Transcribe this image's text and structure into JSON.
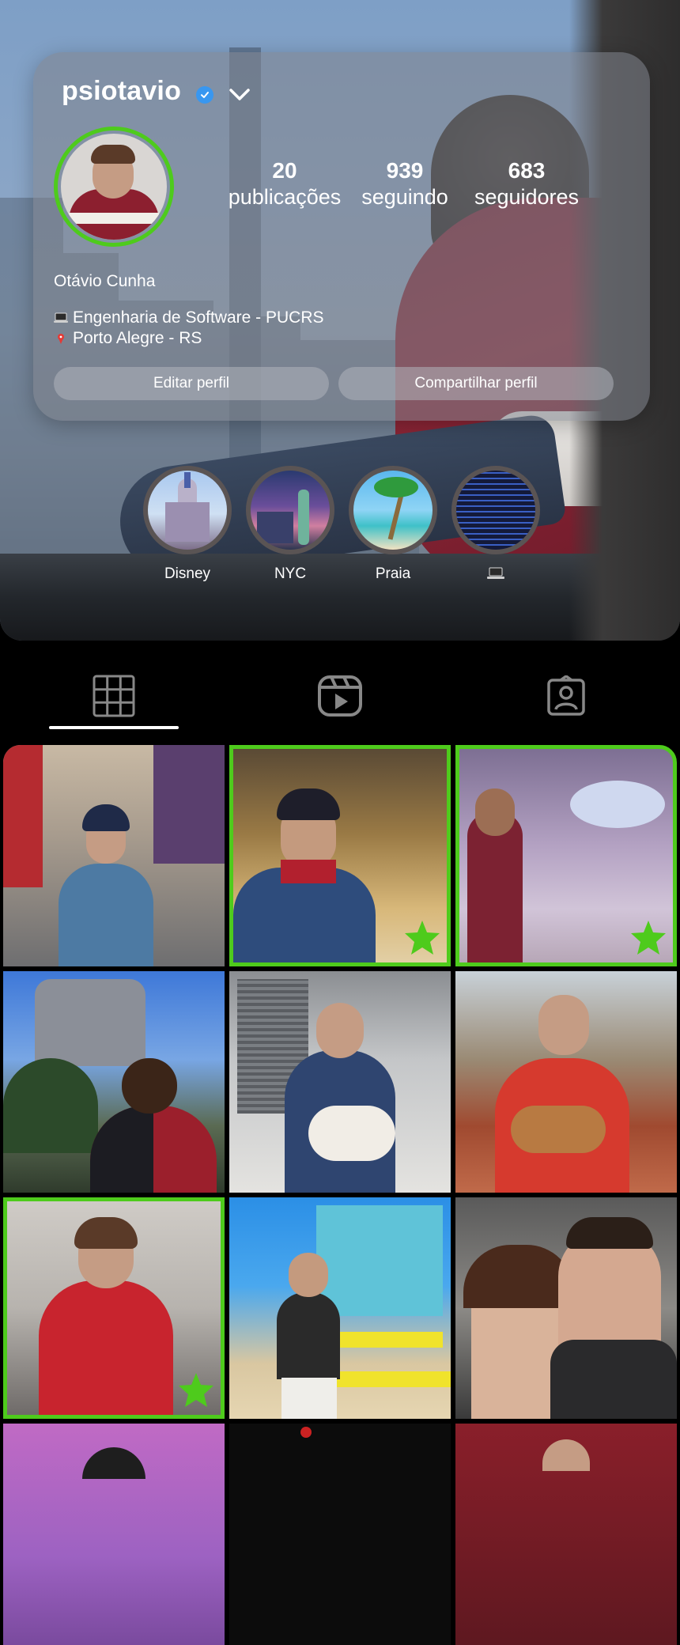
{
  "profile": {
    "username": "psiotavio",
    "full_name": "Otávio Cunha",
    "bio_line1": "Engenharia de Software - PUCRS",
    "bio_line2": "Porto Alegre - RS",
    "stats": [
      {
        "value": "20",
        "label": "publicações"
      },
      {
        "value": "939",
        "label": "seguindo"
      },
      {
        "value": "683",
        "label": "seguidores"
      }
    ],
    "buttons": {
      "edit": "Editar perfil",
      "share": "Compartilhar perfil"
    }
  },
  "highlights": [
    {
      "label": "Disney"
    },
    {
      "label": "NYC"
    },
    {
      "label": "Praia"
    },
    {
      "label": ""
    }
  ],
  "tabs": [
    "grid-icon",
    "reels-icon",
    "tagged-icon"
  ],
  "colors": {
    "accent_green": "#4ecb1c",
    "verified_blue": "#3897f0",
    "background": "#000000"
  }
}
